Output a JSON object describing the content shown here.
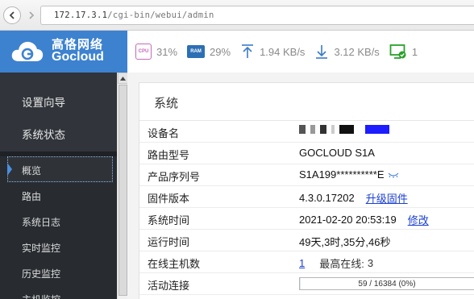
{
  "browser": {
    "url_host": "172.17.3.1",
    "url_path": "/cgi-bin/webui/admin"
  },
  "brand": {
    "name_cn": "高恪网络",
    "name_en": "Gocloud",
    "color": "#3d82cf"
  },
  "stats": {
    "cpu_icon_text": "CPU",
    "cpu": "31%",
    "ram_icon_text": "RAM",
    "ram": "29%",
    "upload": "1.94 KB/s",
    "download": "3.12 KB/s",
    "online": "1"
  },
  "sidebar": {
    "main_items": [
      {
        "label": "设置向导"
      },
      {
        "label": "系统状态"
      }
    ],
    "sub_items": [
      {
        "label": "概览",
        "active": true
      },
      {
        "label": "路由"
      },
      {
        "label": "系统日志"
      },
      {
        "label": "实时监控"
      },
      {
        "label": "历史监控"
      },
      {
        "label": "主机监控"
      }
    ]
  },
  "panel": {
    "title": "系统",
    "rows": {
      "device_name": {
        "label": "设备名"
      },
      "model": {
        "label": "路由型号",
        "value": "GOCLOUD S1A"
      },
      "serial": {
        "label": "产品序列号",
        "value": "S1A199**********E"
      },
      "firmware": {
        "label": "固件版本",
        "value": "4.3.0.17202",
        "link": "升级固件"
      },
      "time": {
        "label": "系统时间",
        "value": "2021-02-20 20:53:19",
        "link": "修改"
      },
      "uptime": {
        "label": "运行时间",
        "value": "49天,3时,35分,46秒"
      },
      "hosts": {
        "label": "在线主机数",
        "value": "1",
        "max_label": "最高在线:",
        "max_value": "3"
      },
      "connections": {
        "label": "活动连接",
        "value": "59 / 16384 (0%)",
        "fill_fraction": 0.0036
      }
    }
  }
}
